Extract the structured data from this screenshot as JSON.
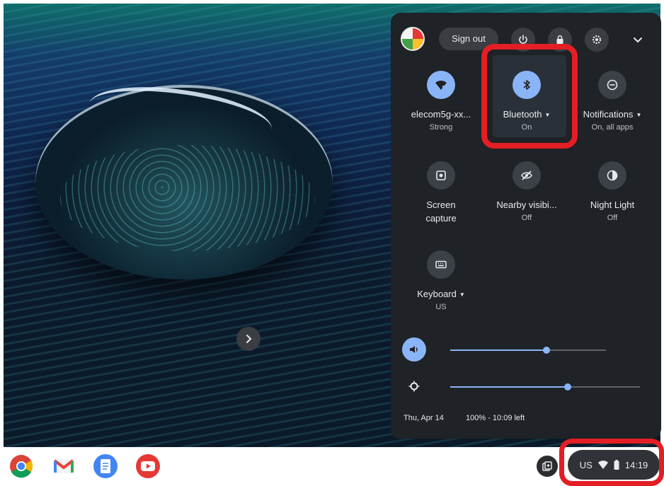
{
  "quick_settings": {
    "sign_out_label": "Sign out",
    "tiles": [
      {
        "label": "elecom5g-xx...",
        "sub": "Strong",
        "icon": "wifi-lock-icon",
        "state": "on"
      },
      {
        "label": "Bluetooth",
        "sub": "On",
        "icon": "bluetooth-icon",
        "state": "on"
      },
      {
        "label": "Notifications",
        "sub": "On, all apps",
        "icon": "notifications-icon",
        "state": "off"
      },
      {
        "label": "Screen",
        "label2": "capture",
        "sub": "",
        "icon": "screen-capture-icon",
        "state": "off"
      },
      {
        "label": "Nearby visibi...",
        "sub": "Off",
        "icon": "nearby-visibility-icon",
        "state": "off"
      },
      {
        "label": "Night Light",
        "sub": "Off",
        "icon": "night-light-icon",
        "state": "off"
      },
      {
        "label": "Keyboard",
        "sub": "US",
        "icon": "keyboard-icon",
        "state": "off"
      }
    ],
    "volume_level": 0.62,
    "brightness_level": 0.62,
    "date": "Thu, Apr 14",
    "battery": "100% - 10:09 left"
  },
  "shelf": {
    "apps": [
      "chrome-icon",
      "gmail-icon",
      "docs-icon",
      "youtube-icon"
    ],
    "tray": {
      "input_method": "US",
      "time": "14:19"
    }
  },
  "colors": {
    "panel": "#1f2226",
    "accent": "#8ab4f8",
    "highlight": "#e31e24"
  }
}
